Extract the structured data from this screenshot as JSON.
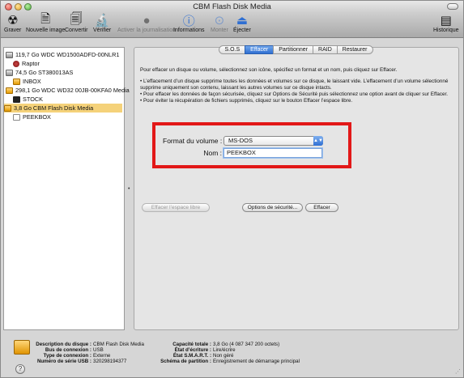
{
  "window": {
    "title": "CBM Flash Disk Media"
  },
  "toolbar": {
    "items": [
      {
        "label": "Graver",
        "icon": "burn-icon"
      },
      {
        "label": "Nouvelle image",
        "icon": "new-image-icon"
      },
      {
        "label": "Convertir",
        "icon": "convert-icon"
      },
      {
        "label": "Vérifier",
        "icon": "verify-icon"
      },
      {
        "label": "Activer la journalisation",
        "icon": "journaling-icon"
      },
      {
        "label": "Informations",
        "icon": "info-icon"
      },
      {
        "label": "Monter",
        "icon": "mount-icon"
      },
      {
        "label": "Éjecter",
        "icon": "eject-icon"
      },
      {
        "label": "Historique",
        "icon": "log-icon"
      }
    ]
  },
  "sidebar": {
    "items": [
      {
        "label": "119,7 Go WDC WD1500ADFD-00NLR1",
        "icon": "hd"
      },
      {
        "label": "Raptor",
        "icon": "red"
      },
      {
        "label": "74,5 Go ST380013AS",
        "icon": "hd"
      },
      {
        "label": "INBOX",
        "icon": "usb"
      },
      {
        "label": "298,1 Go WDC WD32 00JB-00KFA0 Media",
        "icon": "usb"
      },
      {
        "label": "STOCK",
        "icon": "black"
      },
      {
        "label": "3,8 Go CBM Flash Disk Media",
        "icon": "usb"
      },
      {
        "label": "PEEKBOX",
        "icon": "white"
      }
    ]
  },
  "tabs": [
    "S.O.S",
    "Effacer",
    "Partitionner",
    "RAID",
    "Restaurer"
  ],
  "erase": {
    "intro": "Pour effacer un disque ou volume, sélectionnez son icône, spécifiez un format et un nom, puis cliquez sur Effacer.",
    "bullet1": "• L’effacement d’un disque supprime toutes les données et volumes sur ce disque, le laissant vide. L’effacement d’un volume sélectionné supprime uniquement son contenu, laissant les autres volumes sur ce disque intacts.",
    "bullet2": "• Pour effacer les données de façon sécurisée, cliquez sur Options de Sécurité puis sélectionnez une option avant de cliquer sur Effacer.",
    "bullet3": "• Pour éviter la récupération de fichiers supprimés, cliquez sur le bouton Effacer l’espace libre.",
    "format_label": "Format du volume :",
    "format_value": "MS-DOS",
    "name_label": "Nom :",
    "name_value": "PEEKBOX",
    "btn_free_space": "Effacer l’espace libre",
    "btn_security": "Options de sécurité...",
    "btn_erase": "Effacer"
  },
  "info": {
    "desc_k": "Description du disque :",
    "desc_v": "CBM Flash Disk Media",
    "bus_k": "Bus de connexion :",
    "bus_v": "USB",
    "type_k": "Type de connexion :",
    "type_v": "Externe",
    "serial_k": "Numéro de série USB :",
    "serial_v": "320298194377",
    "cap_k": "Capacité totale :",
    "cap_v": "3,8 Go (4 087 347 200 octets)",
    "write_k": "État d’écriture :",
    "write_v": "Lire/écrire",
    "smart_k": "État S.M.A.R.T. :",
    "smart_v": "Non géré",
    "scheme_k": "Schéma de partition :",
    "scheme_v": "Enregistrement de démarrage principal"
  },
  "colors": {
    "highlight": "#e21818",
    "selection": "#f5d27a",
    "tab_active": "#2f6fd2"
  }
}
